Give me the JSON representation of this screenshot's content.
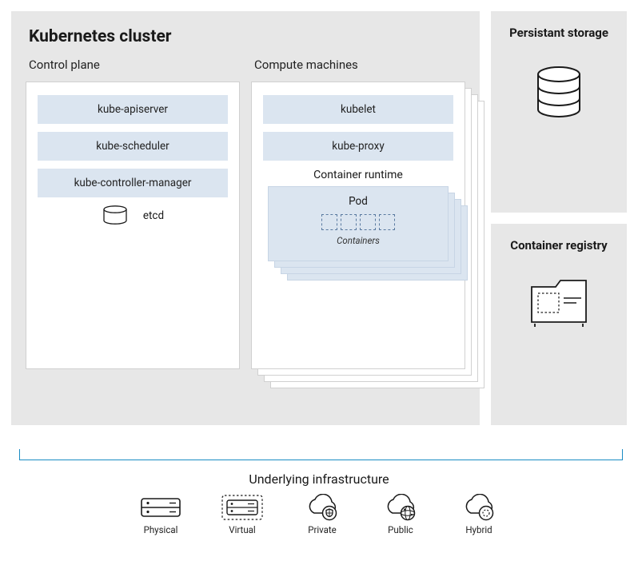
{
  "diagram": {
    "cluster_title": "Kubernetes cluster",
    "control_plane": {
      "label": "Control plane",
      "components": [
        "kube-apiserver",
        "kube-scheduler",
        "kube-controller-manager"
      ],
      "etcd_label": "etcd"
    },
    "compute": {
      "label": "Compute machines",
      "components": [
        "kubelet",
        "kube-proxy"
      ],
      "runtime_label": "Container runtime",
      "pod_label": "Pod",
      "containers_label": "Containers",
      "container_count": 4
    },
    "right": {
      "storage_title": "Persistant storage",
      "registry_title": "Container registry"
    },
    "infra": {
      "title": "Underlying infrastructure",
      "items": [
        {
          "id": "physical",
          "label": "Physical"
        },
        {
          "id": "virtual",
          "label": "Virtual"
        },
        {
          "id": "private",
          "label": "Private"
        },
        {
          "id": "public",
          "label": "Public"
        },
        {
          "id": "hybrid",
          "label": "Hybrid"
        }
      ]
    }
  }
}
